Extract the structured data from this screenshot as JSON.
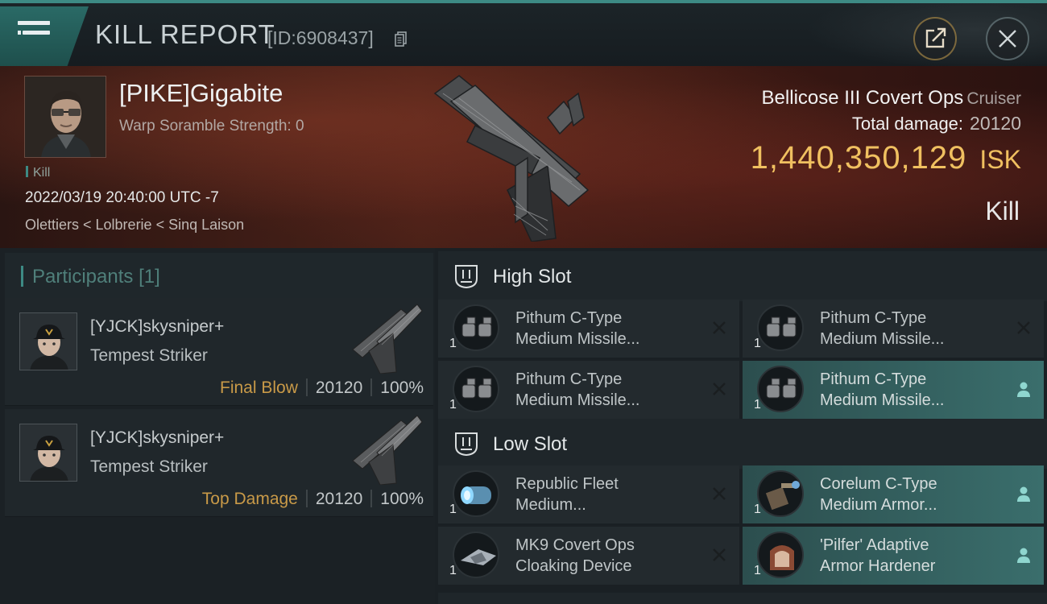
{
  "header": {
    "title": "KILL REPORT",
    "id_label": "[ID:6908437]"
  },
  "victim": {
    "name": "[PIKE]Gigabite",
    "scramble": "Warp Soramble Strength: 0",
    "tag": "Kill",
    "datetime": "2022/03/19 20:40:00 UTC -7",
    "location": "Olettiers < Lolbrerie < Sinq Laison",
    "ship_name": "Bellicose III Covert Ops",
    "ship_class": "Cruiser",
    "total_damage_label": "Total damage:",
    "total_damage": "20120",
    "isk_value": "1,440,350,129",
    "isk_unit": "ISK",
    "result": "Kill"
  },
  "participants": {
    "title": "Participants",
    "count": "[1]",
    "items": [
      {
        "name": "[YJCK]skysniper+",
        "ship": "Tempest Striker",
        "role": "Final Blow",
        "damage": "20120",
        "percent": "100%"
      },
      {
        "name": "[YJCK]skysniper+",
        "ship": "Tempest Striker",
        "role": "Top Damage",
        "damage": "20120",
        "percent": "100%"
      }
    ]
  },
  "slots": {
    "high": {
      "title": "High Slot",
      "modules": [
        {
          "line1": "Pithum C-Type",
          "line2": "Medium Missile...",
          "qty": "1",
          "status": "destroyed"
        },
        {
          "line1": "Pithum C-Type",
          "line2": "Medium Missile...",
          "qty": "1",
          "status": "destroyed"
        },
        {
          "line1": "Pithum C-Type",
          "line2": "Medium Missile...",
          "qty": "1",
          "status": "destroyed"
        },
        {
          "line1": "Pithum C-Type",
          "line2": "Medium Missile...",
          "qty": "1",
          "status": "dropped"
        }
      ]
    },
    "low": {
      "title": "Low Slot",
      "modules": [
        {
          "line1": "Republic Fleet",
          "line2": "Medium...",
          "qty": "1",
          "status": "destroyed"
        },
        {
          "line1": "Corelum C-Type",
          "line2": "Medium Armor...",
          "qty": "1",
          "status": "dropped"
        },
        {
          "line1": "MK9 Covert Ops",
          "line2": "Cloaking Device",
          "qty": "1",
          "status": "destroyed"
        },
        {
          "line1": "'Pilfer' Adaptive",
          "line2": "Armor Hardener",
          "qty": "1",
          "status": "dropped"
        }
      ]
    }
  },
  "colors": {
    "accent": "#3d8a84",
    "isk": "#f0c060",
    "role": "#c99a48",
    "active_module": "#3a6e6c"
  },
  "icons": {
    "menu": "hamburger-menu-icon",
    "copy": "copy-icon",
    "share": "share-icon",
    "close": "close-icon",
    "slot": "slot-icon",
    "destroyed": "x-mark-icon",
    "dropped": "person-icon"
  }
}
